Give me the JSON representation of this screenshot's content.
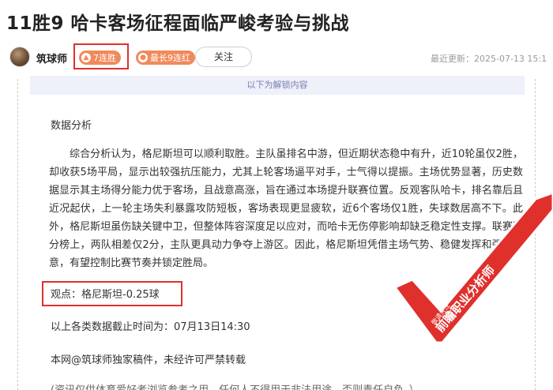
{
  "article": {
    "title": "11胜9 哈卡客场征程面临严峻考验与挑战"
  },
  "author": {
    "name": "筑球师",
    "streak_badge": "7连胜",
    "longest_badge": "最长9连红",
    "follow_label": "关注",
    "updated_label": "最近更新：2025-07-13 15:1"
  },
  "unlock_bar": "以下为解锁内容",
  "body": {
    "section_title": "数据分析",
    "analysis": "综合分析认为，格尼斯坦可以顺利取胜。主队虽排名中游，但近期状态稳中有升，近10轮虽仅2胜，却收获5场平局，显示出较强抗压能力，尤其上轮客场逼平对手，士气得以提振。主场优势显著，历史数据显示其主场得分能力优于客场，且战意高涨，旨在通过本场提升联赛位置。反观客队哈卡，排名靠后且近况起伏，上一轮主场失利暴露攻防短板，客场表现更显疲软，近6个客场仅1胜，失球数居高不下。此外，格尼斯坦虽伤缺关键中卫，但整体阵容深度足以应对，而哈卡无伤停影响却缺乏稳定性支撑。联赛积分榜上，两队相差仅2分，主队更具动力争夺上游区。因此，格尼斯坦凭借主场气势、稳健发挥和强烈战意，有望控制比赛节奏并锁定胜局。",
    "viewpoint": "观点：格尼斯坦-0.25球",
    "cutoff": "以上各类数据截止时间为：07月13日14:30",
    "copyright": "本网@筑球师独家稿件，未经许可严禁转载",
    "disclaimer": "(资讯仅供体育爱好者浏览参考之用，任何人不得用于非法用途，否则责任自负。）"
  },
  "stamp": {
    "text_main": "前瞻职业分析师",
    "text_sub": "敬请关注",
    "color": "#e0302c"
  },
  "colors": {
    "accent_red": "#e0302c",
    "badge_orange": "#f08a5b",
    "unlock_bg": "#eef0fa"
  }
}
